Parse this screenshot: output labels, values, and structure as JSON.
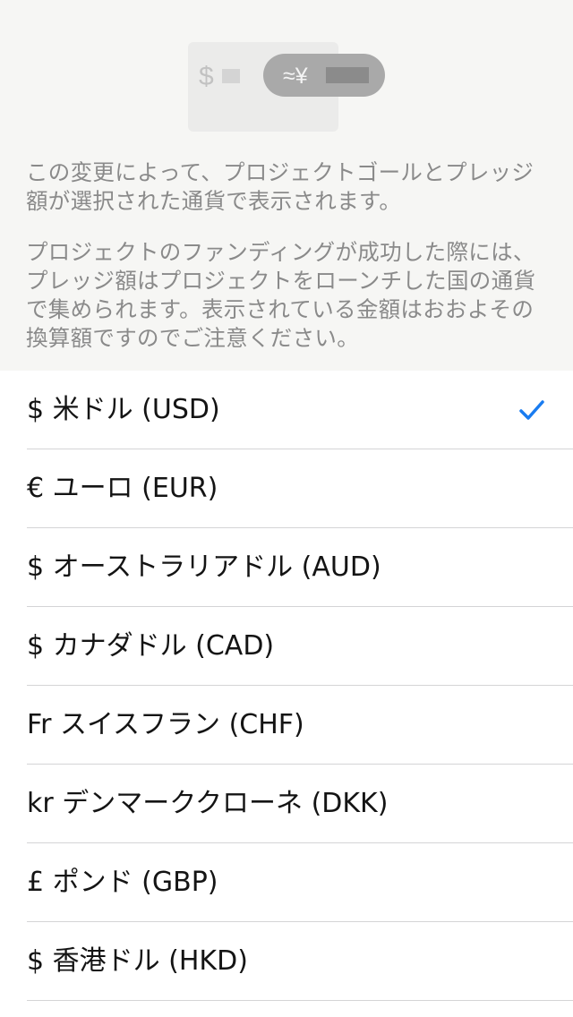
{
  "illustration": {
    "symbol_source": "$",
    "symbol_target": "≈¥"
  },
  "info": {
    "paragraph1": "この変更によって、プロジェクトゴールとプレッジ額が選択された通貨で表示されます。",
    "paragraph2": "プロジェクトのファンディングが成功した際には、プレッジ額はプロジェクトをローンチした国の通貨で集められます。表示されている金額はおおよその換算額ですのでご注意ください。"
  },
  "currencies": [
    {
      "label": "$ 米ドル (USD)",
      "selected": true
    },
    {
      "label": "€ ユーロ (EUR)",
      "selected": false
    },
    {
      "label": "$ オーストラリアドル (AUD)",
      "selected": false
    },
    {
      "label": "$ カナダドル (CAD)",
      "selected": false
    },
    {
      "label": "Fr スイスフラン (CHF)",
      "selected": false
    },
    {
      "label": "kr デンマーククローネ (DKK)",
      "selected": false
    },
    {
      "label": "£ ポンド (GBP)",
      "selected": false
    },
    {
      "label": "$ 香港ドル (HKD)",
      "selected": false
    }
  ],
  "colors": {
    "accent": "#1a7cf0",
    "header_background": "#f6f6f4",
    "info_text": "#8a8a8a",
    "separator": "#d4d4d6"
  },
  "icons": {
    "selected_marker": "checkmark-icon"
  }
}
